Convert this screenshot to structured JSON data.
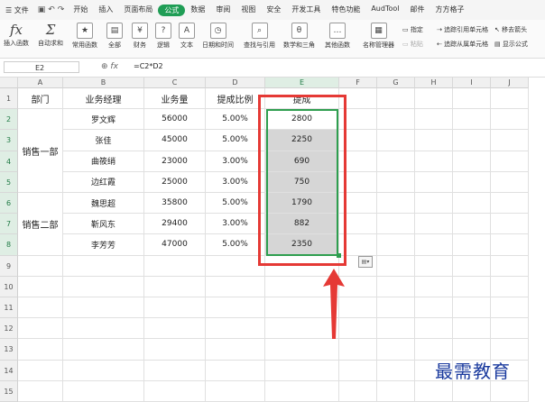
{
  "menubar": {
    "file": "文件",
    "tabs": [
      "开始",
      "插入",
      "页面布局",
      "公式",
      "数据",
      "审阅",
      "视图",
      "安全",
      "开发工具",
      "特色功能",
      "AudTool",
      "邮件",
      "方方格子"
    ],
    "active_tab": "公式"
  },
  "ribbon": {
    "buttons": [
      "插入函数",
      "自动求和",
      "常用函数",
      "全部",
      "财务",
      "逻辑",
      "文本",
      "日期和时间",
      "查找与引用",
      "数学和三角",
      "其他函数",
      "名称管理器"
    ],
    "small": [
      "指定",
      "粘贴",
      "追踪引用单元格",
      "追踪从属单元格",
      "移去箭头",
      "显示公式"
    ]
  },
  "formula_bar": {
    "name_box": "E2",
    "formula": "=C2*D2"
  },
  "columns": [
    "A",
    "B",
    "C",
    "D",
    "E",
    "F",
    "G",
    "H",
    "I",
    "J"
  ],
  "rows": [
    "1",
    "2",
    "3",
    "4",
    "5",
    "6",
    "7",
    "8",
    "9",
    "10",
    "11",
    "12",
    "13",
    "14",
    "15"
  ],
  "table": {
    "headers": [
      "部门",
      "业务经理",
      "业务量",
      "提成比例",
      "提成"
    ],
    "dept1": "销售一部",
    "dept2": "销售二部",
    "records": [
      {
        "name": "罗文辉",
        "volume": "56000",
        "rate": "5.00%",
        "commission": "2800"
      },
      {
        "name": "张佳",
        "volume": "45000",
        "rate": "5.00%",
        "commission": "2250"
      },
      {
        "name": "曲筱绡",
        "volume": "23000",
        "rate": "3.00%",
        "commission": "690"
      },
      {
        "name": "边红霞",
        "volume": "25000",
        "rate": "3.00%",
        "commission": "750"
      },
      {
        "name": "魏思超",
        "volume": "35800",
        "rate": "5.00%",
        "commission": "1790"
      },
      {
        "name": "靳风东",
        "volume": "29400",
        "rate": "3.00%",
        "commission": "882"
      },
      {
        "name": "李芳芳",
        "volume": "47000",
        "rate": "5.00%",
        "commission": "2350"
      }
    ]
  },
  "watermark": "最需教育"
}
